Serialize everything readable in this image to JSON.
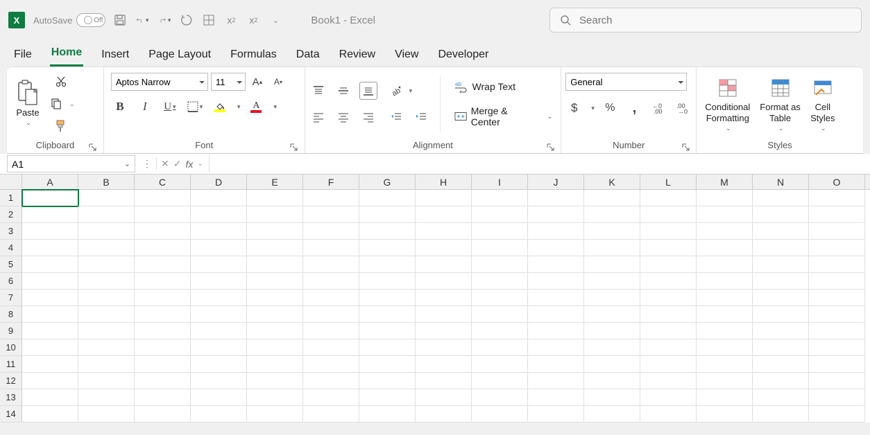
{
  "titlebar": {
    "autosave_label": "AutoSave",
    "autosave_state": "Off",
    "doc_title": "Book1  -  Excel",
    "search_placeholder": "Search"
  },
  "tabs": [
    "File",
    "Home",
    "Insert",
    "Page Layout",
    "Formulas",
    "Data",
    "Review",
    "View",
    "Developer"
  ],
  "active_tab": "Home",
  "ribbon": {
    "clipboard": {
      "label": "Clipboard",
      "paste": "Paste"
    },
    "font": {
      "label": "Font",
      "font_name": "Aptos Narrow",
      "font_size": "11"
    },
    "alignment": {
      "label": "Alignment",
      "wrap": "Wrap Text",
      "merge": "Merge & Center"
    },
    "number": {
      "label": "Number",
      "format": "General"
    },
    "styles": {
      "label": "Styles",
      "conditional": "Conditional\nFormatting",
      "table": "Format as\nTable",
      "cell": "Cell\nStyles"
    }
  },
  "name_box": "A1",
  "formula_value": "",
  "columns": [
    "A",
    "B",
    "C",
    "D",
    "E",
    "F",
    "G",
    "H",
    "I",
    "J",
    "K",
    "L",
    "M",
    "N",
    "O"
  ],
  "rows": [
    1,
    2,
    3,
    4,
    5,
    6,
    7,
    8,
    9,
    10,
    11,
    12,
    13,
    14
  ],
  "active_cell": "A1"
}
